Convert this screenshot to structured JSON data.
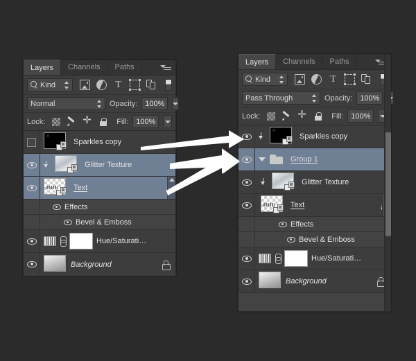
{
  "app": {
    "name": "Adobe Photoshop Layers Panel",
    "colors": {
      "panel_bg": "#3d3d3d",
      "row_bg": "#3d3d3d",
      "selected_row": "#6f7f94",
      "canvas_bg": "#2b2b2b",
      "text": "#e3e3e3",
      "arrow": "#ffffff"
    }
  },
  "panels": [
    {
      "id": "before",
      "tabs": [
        {
          "label": "Layers",
          "active": true
        },
        {
          "label": "Channels",
          "active": false
        },
        {
          "label": "Paths",
          "active": false
        }
      ],
      "menu_icon": "panel-menu-icon",
      "filter": {
        "search_icon": "magnifier-icon",
        "kind_label": "Kind",
        "stepper_icon": "stepper-arrows-icon",
        "filter_icons": [
          "pixel-layer-filter-icon",
          "adjustment-layer-filter-icon",
          "type-layer-filter-icon",
          "shape-layer-filter-icon",
          "smart-object-filter-icon"
        ],
        "toggle_icon": "filter-enable-toggle-icon"
      },
      "blend": {
        "mode": "Normal",
        "opacity_label": "Opacity:",
        "opacity_value": "100%"
      },
      "lock": {
        "lock_label": "Lock:",
        "lock_icons": [
          "lock-transparent-pixels-icon",
          "lock-image-pixels-icon",
          "lock-position-icon",
          "lock-all-icon"
        ],
        "fill_label": "Fill:",
        "fill_value": "100%"
      },
      "layers": [
        {
          "name": "Sparkles copy",
          "visible": false,
          "selected": false,
          "kind": "smart-object",
          "thumb": "sparkles",
          "clipped": false,
          "indent": 0
        },
        {
          "name": "Glitter Texture",
          "visible": true,
          "selected": true,
          "kind": "smart-object",
          "thumb": "glitter",
          "clipped": true,
          "indent": 0
        },
        {
          "name": "Text",
          "visible": true,
          "selected": true,
          "kind": "smart-object",
          "thumb": "checker",
          "clipped": false,
          "indent": 0,
          "fx": "fx",
          "underline": true
        }
      ],
      "effects": {
        "label": "Effects",
        "items": [
          "Bevel & Emboss"
        ]
      },
      "lower_layers": [
        {
          "name": "Hue/Saturati…",
          "visible": true,
          "kind": "adjustment",
          "thumb": "white-mask"
        },
        {
          "name": "Background",
          "visible": true,
          "kind": "background",
          "thumb": "gradient",
          "locked": true,
          "italic": true
        }
      ]
    },
    {
      "id": "after",
      "tabs": [
        {
          "label": "Layers",
          "active": true
        },
        {
          "label": "Channels",
          "active": false
        },
        {
          "label": "Paths",
          "active": false
        }
      ],
      "menu_icon": "panel-menu-icon",
      "filter": {
        "search_icon": "magnifier-icon",
        "kind_label": "Kind",
        "stepper_icon": "stepper-arrows-icon",
        "filter_icons": [
          "pixel-layer-filter-icon",
          "adjustment-layer-filter-icon",
          "type-layer-filter-icon",
          "shape-layer-filter-icon",
          "smart-object-filter-icon"
        ],
        "toggle_icon": "filter-enable-toggle-icon"
      },
      "blend": {
        "mode": "Pass Through",
        "opacity_label": "Opacity:",
        "opacity_value": "100%"
      },
      "lock": {
        "lock_label": "Lock:",
        "lock_icons": [
          "lock-transparent-pixels-icon",
          "lock-image-pixels-icon",
          "lock-position-icon",
          "lock-all-icon"
        ],
        "fill_label": "Fill:",
        "fill_value": "100%"
      },
      "layers": [
        {
          "name": "Sparkles copy",
          "visible": true,
          "selected": false,
          "kind": "smart-object",
          "thumb": "sparkles",
          "clipped": true,
          "indent": 0
        },
        {
          "name": "Group 1",
          "visible": true,
          "selected": true,
          "kind": "group",
          "expanded": true,
          "underline": true,
          "indent": 0
        },
        {
          "name": "Glitter Texture",
          "visible": true,
          "selected": false,
          "kind": "smart-object",
          "thumb": "glitter",
          "clipped": true,
          "indent": 1
        },
        {
          "name": "Text",
          "visible": true,
          "selected": false,
          "kind": "smart-object",
          "thumb": "checker",
          "clipped": false,
          "indent": 1,
          "fx": "fx",
          "underline": true
        }
      ],
      "effects": {
        "label": "Effects",
        "items": [
          "Bevel & Emboss"
        ]
      },
      "lower_layers": [
        {
          "name": "Hue/Saturati…",
          "visible": true,
          "kind": "adjustment",
          "thumb": "white-mask"
        },
        {
          "name": "Background",
          "visible": true,
          "kind": "background",
          "thumb": "gradient",
          "locked": true,
          "italic": true
        }
      ]
    }
  ],
  "annotations": {
    "arrows": [
      {
        "id": "arrow-sparkles",
        "from": "before.sparkles-copy",
        "to": "after.sparkles-copy"
      },
      {
        "id": "arrow-glitter-to-group",
        "from": "before.glitter-texture",
        "to": "after.group-1"
      },
      {
        "id": "arrow-text-to-group",
        "from": "before.text",
        "to": "after.group-1"
      }
    ]
  }
}
